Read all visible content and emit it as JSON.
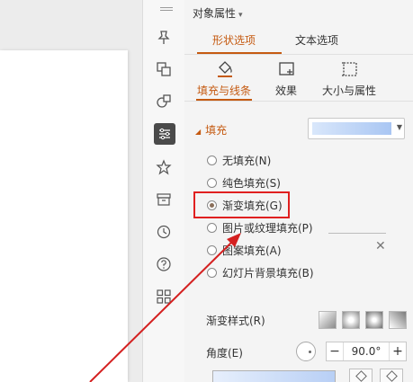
{
  "panel": {
    "title": "对象属性",
    "title_caret": "▾",
    "tabs": [
      {
        "label": "形状选项",
        "active": true
      },
      {
        "label": "文本选项",
        "active": false
      }
    ],
    "subtabs": [
      {
        "label": "填充与线条",
        "icon": "paint-bucket-icon",
        "active": true
      },
      {
        "label": "效果",
        "icon": "effects-icon",
        "active": false
      },
      {
        "label": "大小与属性",
        "icon": "size-properties-icon",
        "active": false
      }
    ],
    "fill_section": {
      "header": "填充",
      "options": [
        {
          "label": "无填充(N)",
          "checked": false
        },
        {
          "label": "纯色填充(S)",
          "checked": false
        },
        {
          "label": "渐变填充(G)",
          "checked": true
        },
        {
          "label": "图片或纹理填充(P)",
          "checked": false
        },
        {
          "label": "图案填充(A)",
          "checked": false
        },
        {
          "label": "幻灯片背景填充(B)",
          "checked": false
        }
      ]
    },
    "gradient": {
      "style_label": "渐变样式(R)",
      "angle_label": "角度(E)",
      "angle_value": "90.0°",
      "minus": "−",
      "plus": "+"
    },
    "close_symbol": "✕"
  },
  "colors": {
    "accent": "#c55a11",
    "highlight": "#e02020",
    "gradient_start": "#d9e7fb",
    "gradient_end": "#a9c6f3"
  },
  "sidebar_icons": [
    "pin-icon",
    "shapes-icon",
    "objects-icon",
    "properties-icon",
    "star-icon",
    "archive-icon",
    "history-icon",
    "help-icon",
    "apps-icon"
  ]
}
